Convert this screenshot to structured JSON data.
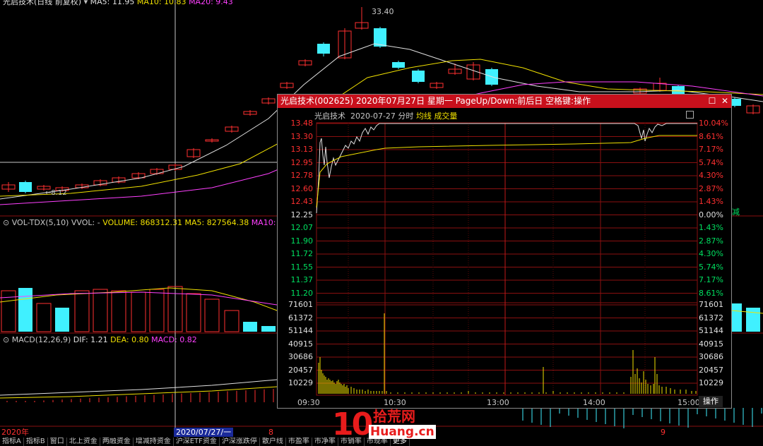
{
  "main_chart": {
    "title_line": {
      "stock": "光启技术(日线 前复权)",
      "ma5": "MA5: 11.95",
      "ma10": "MA10: 10.83",
      "ma20": "MA20: 9.43"
    },
    "peak_label": "33.40",
    "low_label": "8.12",
    "colors": {
      "up": "#ff3030",
      "down": "#40f0ff",
      "ma5": "#e0e0e0",
      "ma10": "#f0e000",
      "ma20": "#ff40ff",
      "crosshair": "#c8c8c8"
    }
  },
  "volume_pane": {
    "label": "VOL-TDX(5,10)",
    "vvol": "VVOL: -",
    "volume": "VOLUME: 868312.31",
    "ma5": "MA5: 827564.38",
    "ma10": "MA10:"
  },
  "macd_pane": {
    "label": "MACD(12,26,9)",
    "dif": "DIF: 1.21",
    "dea": "DEA: 0.80",
    "macd": "MACD: 0.82"
  },
  "side_note": "减",
  "popup": {
    "title": "光启技术(002625) 2020年07月27日 星期一 PageUp/Down:前后日 空格键:操作",
    "subtitle_name": "光启技术",
    "subtitle_date": "2020-07-27 分时",
    "subtitle_avg": "均线",
    "subtitle_vol": "成交量",
    "price_ticks": [
      "13.48",
      "13.30",
      "13.13",
      "12.95",
      "12.78",
      "12.60",
      "12.43",
      "12.25",
      "12.07",
      "11.90",
      "11.72",
      "11.55",
      "11.37",
      "11.20"
    ],
    "pct_ticks": [
      "10.04%",
      "8.61%",
      "7.17%",
      "5.74%",
      "4.30%",
      "2.87%",
      "1.43%",
      "0.00%",
      "1.43%",
      "2.87%",
      "4.30%",
      "5.74%",
      "7.17%",
      "8.61%"
    ],
    "vol_ticks": [
      "71601",
      "61372",
      "51144",
      "40915",
      "30686",
      "20457",
      "10229"
    ],
    "time_ticks": [
      "09:30",
      "10:30",
      "13:00",
      "14:00",
      "15:00"
    ],
    "op_button": "操作",
    "colors": {
      "price": "#e0e0e0",
      "avg": "#f0e000",
      "volume": "#f0e000",
      "grid": "#8a1010",
      "title_bg": "#c8101c"
    }
  },
  "date_strip": {
    "year": "2020年",
    "current": "2020/07/27/一",
    "m8": "8",
    "m9": "9"
  },
  "bottom_tabs": [
    "指标A",
    "指标B",
    "窗口",
    "北上资金",
    "两融资金",
    "增减持资金",
    "沪深ETF资金",
    "沪深涨跌停",
    "散户线",
    "市盈率",
    "市净率",
    "市销率",
    "市现率",
    "更多"
  ],
  "watermark": {
    "ten": "10",
    "cn": "拾荒网",
    "en": "Huang.cn"
  }
}
